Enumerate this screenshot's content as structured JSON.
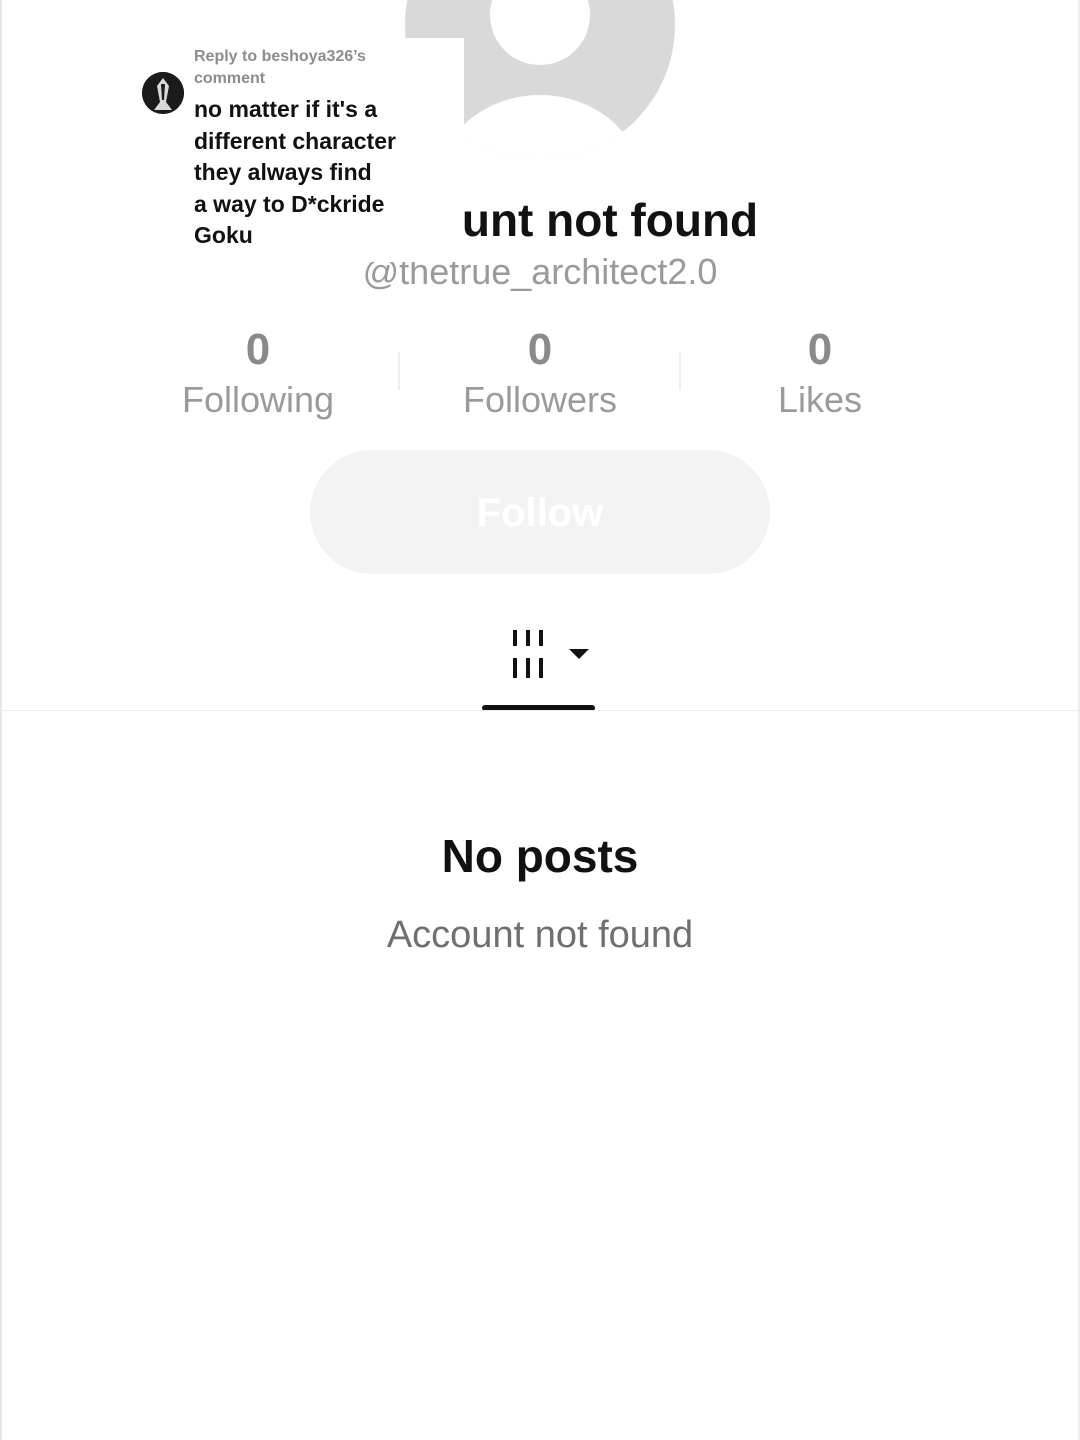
{
  "profile": {
    "title_partial": "unt not found",
    "handle": "@thetrue_architect2.0"
  },
  "stats": [
    {
      "value": "0",
      "label": "Following"
    },
    {
      "value": "0",
      "label": "Followers"
    },
    {
      "value": "0",
      "label": "Likes"
    }
  ],
  "follow_button": {
    "label": "Follow"
  },
  "tabs": {
    "icon": "grid-filter-icon",
    "indicator": "triangle-down-icon"
  },
  "empty_state": {
    "title": "No posts",
    "subtitle": "Account not found"
  },
  "reply": {
    "header_line1": "Reply to beshoya326’s",
    "header_line2": "comment",
    "lines": [
      "no matter if it's a",
      "different character",
      "they always find",
      "a way to D*ckride",
      "Goku"
    ]
  },
  "colors": {
    "avatar_placeholder": "#d9d9d9",
    "follow_button_bg": "#f3f3f3",
    "muted_text": "#9a9a9a"
  }
}
